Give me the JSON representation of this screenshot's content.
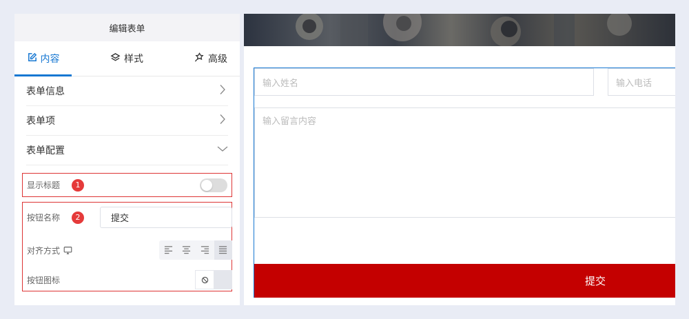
{
  "panel": {
    "title": "编辑表单",
    "tabs": [
      {
        "label": "内容",
        "icon": "edit-icon",
        "active": true
      },
      {
        "label": "样式",
        "icon": "layers-icon",
        "active": false
      },
      {
        "label": "高级",
        "icon": "settings-icon",
        "active": false
      }
    ],
    "sections": [
      {
        "label": "表单信息",
        "icon": "chevron-right-icon"
      },
      {
        "label": "表单项",
        "icon": "chevron-right-icon"
      },
      {
        "label": "表单配置",
        "icon": "chevron-down-icon"
      }
    ],
    "config": {
      "show_title_label": "显示标题",
      "show_title_badge": "1",
      "show_title_on": false,
      "button_name_label": "按钮名称",
      "button_name_badge": "2",
      "button_name_value": "提交",
      "align_label": "对齐方式",
      "align_options": [
        "left",
        "center",
        "right",
        "justify"
      ],
      "align_selected": "justify",
      "button_icon_label": "按钮图标"
    }
  },
  "preview": {
    "name_placeholder": "输入姓名",
    "phone_placeholder": "输入电话",
    "message_placeholder": "输入留言内容",
    "submit_label": "提交"
  },
  "colors": {
    "accent": "#1677d2",
    "submit_bg": "#c40000",
    "highlight_border": "#dd3333",
    "badge": "#e53a3a"
  }
}
